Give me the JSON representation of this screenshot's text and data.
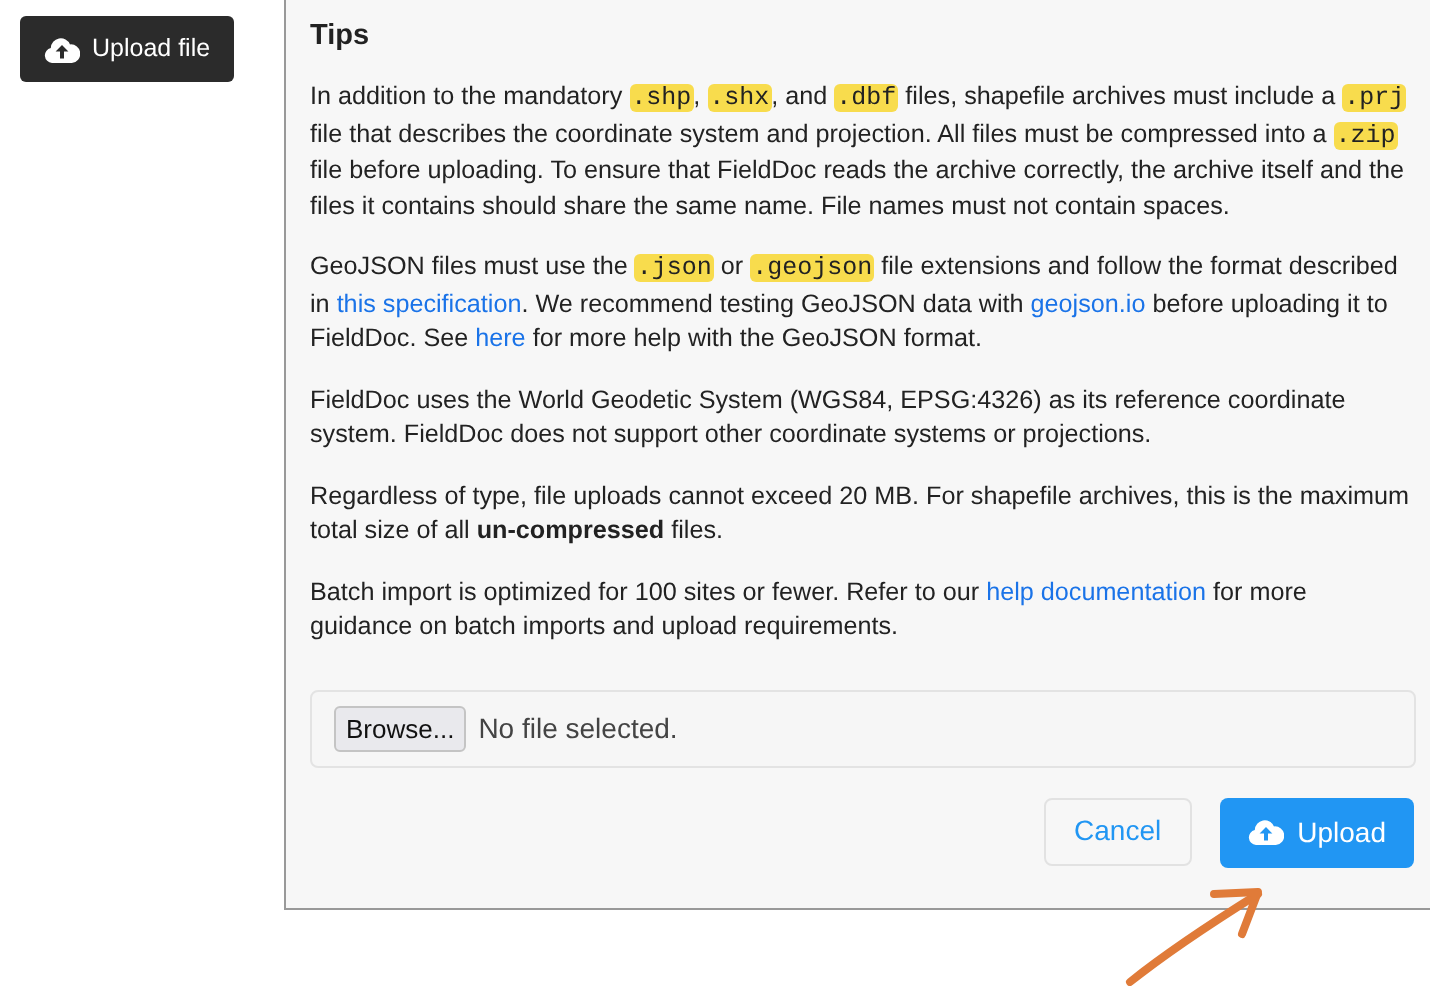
{
  "upload_file_button": {
    "label": "Upload file"
  },
  "tips": {
    "title": "Tips",
    "paragraphs": [
      [
        {
          "kind": "text",
          "text": "In addition to the mandatory "
        },
        {
          "kind": "code",
          "text": ".shp"
        },
        {
          "kind": "text",
          "text": ", "
        },
        {
          "kind": "code",
          "text": ".shx"
        },
        {
          "kind": "text",
          "text": ", and "
        },
        {
          "kind": "code",
          "text": ".dbf"
        },
        {
          "kind": "text",
          "text": " files, shapefile archives must include a "
        },
        {
          "kind": "code",
          "text": ".prj"
        },
        {
          "kind": "text",
          "text": " file that describes the coordinate system and projection. All files must be compressed into a "
        },
        {
          "kind": "code",
          "text": ".zip"
        },
        {
          "kind": "text",
          "text": " file before uploading. To ensure that FieldDoc reads the archive correctly, the archive itself and the files it contains should share the same name. File names must not contain spaces."
        }
      ],
      [
        {
          "kind": "text",
          "text": "GeoJSON files must use the "
        },
        {
          "kind": "code",
          "text": ".json"
        },
        {
          "kind": "text",
          "text": " or "
        },
        {
          "kind": "code",
          "text": ".geojson"
        },
        {
          "kind": "text",
          "text": " file extensions and follow the format described in "
        },
        {
          "kind": "link",
          "text": "this specification"
        },
        {
          "kind": "text",
          "text": ". We recommend testing GeoJSON data with "
        },
        {
          "kind": "link",
          "text": "geojson.io"
        },
        {
          "kind": "text",
          "text": " before uploading it to FieldDoc. See "
        },
        {
          "kind": "link",
          "text": "here"
        },
        {
          "kind": "text",
          "text": " for more help with the GeoJSON format."
        }
      ],
      [
        {
          "kind": "text",
          "text": "FieldDoc uses the World Geodetic System (WGS84, EPSG:4326) as its reference coordinate system. FieldDoc does not support other coordinate systems or projections."
        }
      ],
      [
        {
          "kind": "text",
          "text": "Regardless of type, file uploads cannot exceed 20 MB. For shapefile archives, this is the maximum total size of all "
        },
        {
          "kind": "bold",
          "text": "un-compressed"
        },
        {
          "kind": "text",
          "text": " files."
        }
      ],
      [
        {
          "kind": "text",
          "text": "Batch import is optimized for 100 sites or fewer. Refer to our "
        },
        {
          "kind": "link",
          "text": "help documentation"
        },
        {
          "kind": "text",
          "text": " for more guidance on batch imports and upload requirements."
        }
      ]
    ]
  },
  "file_input": {
    "button": "Browse...",
    "status": "No file selected."
  },
  "buttons": [
    {
      "kind": "secondary",
      "label": "Cancel"
    },
    {
      "kind": "primary",
      "label": "Upload"
    }
  ]
}
